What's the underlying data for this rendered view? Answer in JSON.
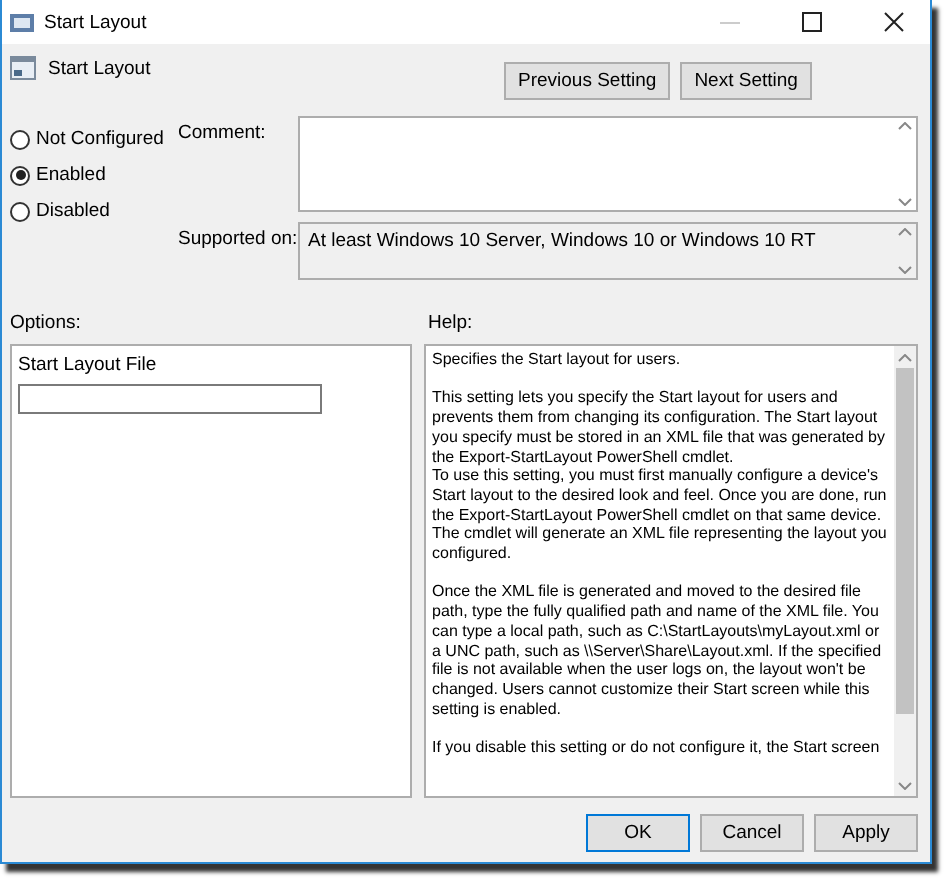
{
  "window": {
    "title": "Start Layout"
  },
  "policy": {
    "name": "Start Layout"
  },
  "nav_buttons": [
    "Previous Setting",
    "Next Setting"
  ],
  "states": [
    {
      "label": "Not Configured",
      "selected": false
    },
    {
      "label": "Enabled",
      "selected": true
    },
    {
      "label": "Disabled",
      "selected": false
    }
  ],
  "comment": {
    "label": "Comment:"
  },
  "supported_on": {
    "label": "Supported on:",
    "value": "At least Windows 10 Server, Windows 10 or Windows 10 RT"
  },
  "options": {
    "label": "Options:",
    "field_label": "Start Layout File"
  },
  "help": {
    "label": "Help:",
    "paragraphs": [
      {
        "lines": [
          "Specifies the Start layout for users."
        ]
      },
      {
        "lines": [
          "This setting lets you specify the Start layout for users and prevents them from changing its configuration. The Start layout you specify must be stored in an XML file that was generated by the Export-StartLayout PowerShell cmdlet.",
          "To use this setting, you must first manually configure a device's Start layout to the desired look and feel. Once you are done, run the Export-StartLayout PowerShell cmdlet on that same device. The cmdlet will generate an XML file representing the layout you configured."
        ]
      },
      {
        "lines": [
          "Once the XML file is generated and moved to the desired file path, type the fully qualified path and name of the XML file. You can type a local path, such as C:\\StartLayouts\\myLayout.xml or a UNC path, such as \\\\Server\\Share\\Layout.xml. If the specified file is not available when the user logs on, the layout won't be changed. Users cannot customize their Start screen while this setting is enabled."
        ]
      },
      {
        "lines": [
          "If you disable this setting or do not configure it, the Start screen"
        ]
      }
    ]
  },
  "buttons": [
    "OK",
    "Cancel",
    "Apply"
  ]
}
